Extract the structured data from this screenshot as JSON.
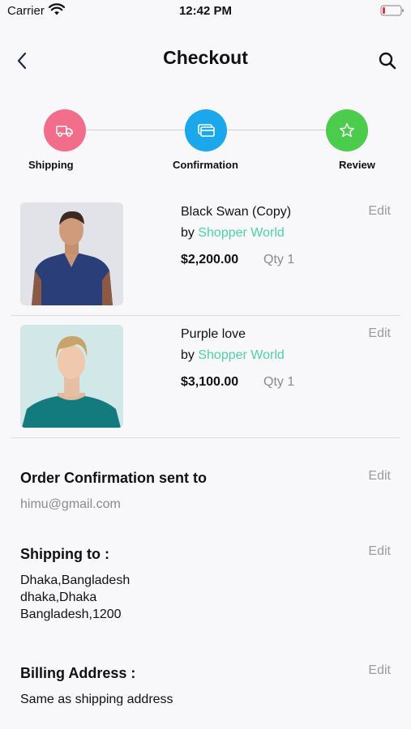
{
  "status_bar": {
    "carrier": "Carrier",
    "time": "12:42 PM"
  },
  "nav": {
    "title": "Checkout",
    "back_icon": "chevron-left-icon",
    "search_icon": "search-icon"
  },
  "stepper": {
    "steps": [
      {
        "label": "Shipping",
        "icon": "truck-icon",
        "color": "#f16d8a"
      },
      {
        "label": "Confirmation",
        "icon": "card-icon",
        "color": "#1aa7ec"
      },
      {
        "label": "Review",
        "icon": "star-icon",
        "color": "#4ccc4c"
      }
    ]
  },
  "cart": {
    "items": [
      {
        "name": "Black Swan (Copy)",
        "by": "by",
        "seller": "Shopper World",
        "price": "$2,200.00",
        "qty": "Qty 1",
        "edit": "Edit"
      },
      {
        "name": "Purple love",
        "by": "by",
        "seller": "Shopper World",
        "price": "$3,100.00",
        "qty": "Qty 1",
        "edit": "Edit"
      }
    ]
  },
  "order_confirmation": {
    "title": "Order Confirmation sent to",
    "email": "himu@gmail.com",
    "edit": "Edit"
  },
  "shipping": {
    "title": "Shipping to :",
    "line1": "Dhaka,Bangladesh",
    "line2": "dhaka,Dhaka",
    "line3": "Bangladesh,1200",
    "edit": "Edit"
  },
  "billing": {
    "title": "Billing Address :",
    "text": "Same as shipping address",
    "edit": "Edit"
  },
  "colors": {
    "accent": "#4cd2a6",
    "background": "#f8f8fa"
  }
}
